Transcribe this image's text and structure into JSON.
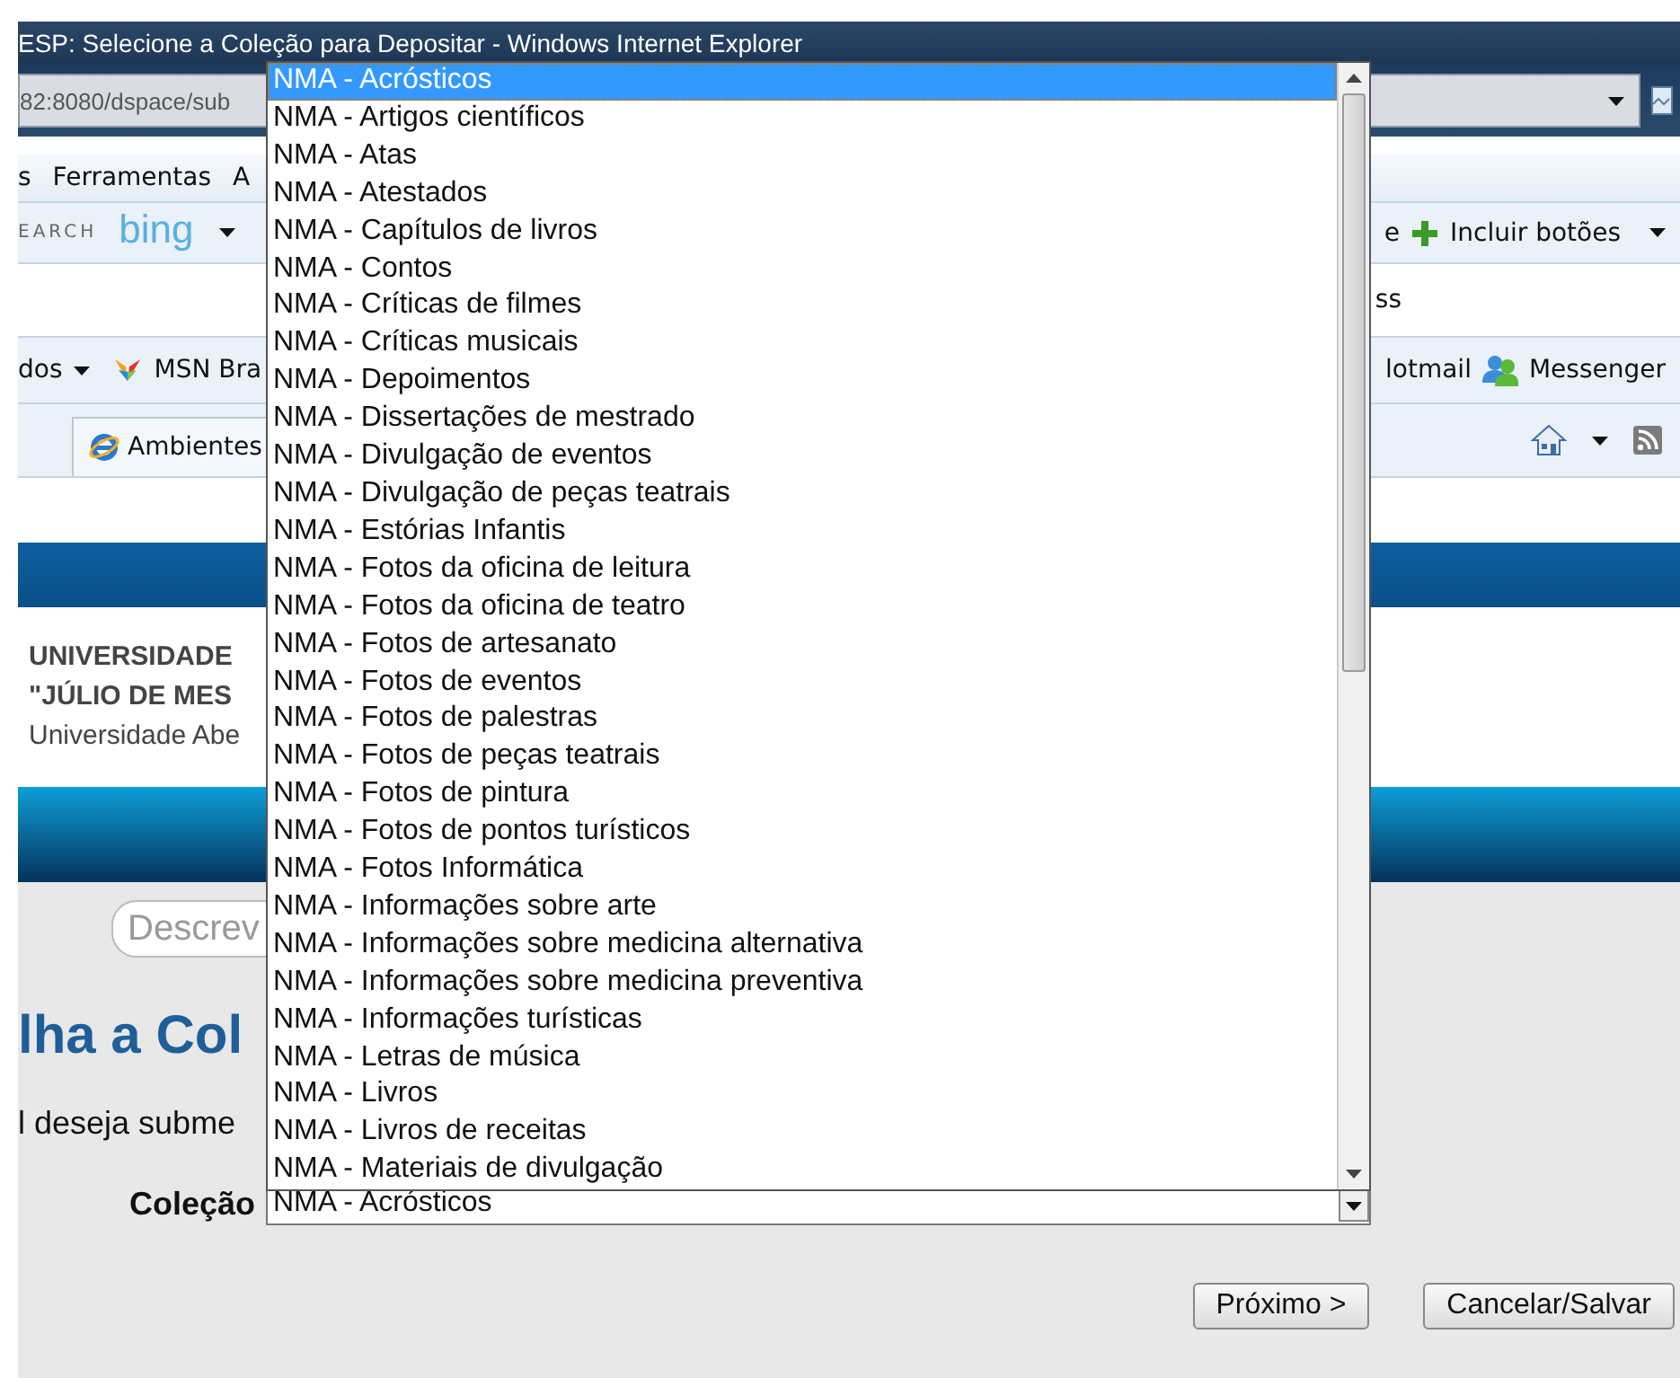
{
  "window": {
    "title": "ESP: Selecione a Coleção para Depositar - Windows Internet Explorer"
  },
  "address_bar": {
    "url": "82:8080/dspace/sub"
  },
  "menu_bar": {
    "items": [
      "s",
      "Ferramentas",
      "A"
    ]
  },
  "search_toolbar": {
    "label": "EARCH",
    "logo": "bing",
    "right_items": [
      "e",
      "Incluir botões"
    ]
  },
  "links_row": {
    "text": "ss"
  },
  "favorites_bar": {
    "items": [
      {
        "label": "dos",
        "kind": "menu"
      },
      {
        "label": "MSN Bra",
        "kind": "msn"
      },
      {
        "label": "lotmail",
        "kind": "plain"
      },
      {
        "label": "Messenger",
        "kind": "messenger"
      }
    ]
  },
  "tab_row": {
    "tab_label": "Ambientes"
  },
  "header": {
    "lines": [
      "UNIVERSIDADE",
      "\"JÚLIO DE MES",
      "Universidade Abe"
    ]
  },
  "page": {
    "search_placeholder": "Descrev",
    "heading": "lha a Col",
    "prompt": "l deseja subme",
    "field_label": "Coleção",
    "selected_value": "NMA - Acrósticos"
  },
  "dropdown": {
    "options": [
      {
        "label": "NMA - Acrósticos",
        "selected": true
      },
      {
        "label": "NMA - Artigos científicos",
        "selected": false
      },
      {
        "label": "NMA - Atas",
        "selected": false
      },
      {
        "label": "NMA - Atestados",
        "selected": false
      },
      {
        "label": "NMA - Capítulos de livros",
        "selected": false
      },
      {
        "label": "NMA - Contos",
        "selected": false
      },
      {
        "label": "NMA - Críticas de filmes",
        "selected": false
      },
      {
        "label": "NMA - Críticas musicais",
        "selected": false
      },
      {
        "label": "NMA - Depoimentos",
        "selected": false
      },
      {
        "label": "NMA - Dissertações de mestrado",
        "selected": false
      },
      {
        "label": "NMA - Divulgação de eventos",
        "selected": false
      },
      {
        "label": "NMA - Divulgação de peças teatrais",
        "selected": false
      },
      {
        "label": "NMA - Estórias Infantis",
        "selected": false
      },
      {
        "label": "NMA - Fotos da oficina de leitura",
        "selected": false
      },
      {
        "label": "NMA - Fotos da oficina de teatro",
        "selected": false
      },
      {
        "label": "NMA - Fotos de artesanato",
        "selected": false
      },
      {
        "label": "NMA - Fotos de eventos",
        "selected": false
      },
      {
        "label": "NMA - Fotos de palestras",
        "selected": false
      },
      {
        "label": "NMA - Fotos de peças teatrais",
        "selected": false
      },
      {
        "label": "NMA - Fotos de pintura",
        "selected": false
      },
      {
        "label": "NMA - Fotos de pontos turísticos",
        "selected": false
      },
      {
        "label": "NMA - Fotos Informática",
        "selected": false
      },
      {
        "label": "NMA - Informações sobre arte",
        "selected": false
      },
      {
        "label": "NMA - Informações sobre medicina alternativa",
        "selected": false
      },
      {
        "label": "NMA - Informações sobre medicina preventiva",
        "selected": false
      },
      {
        "label": "NMA - Informações turísticas",
        "selected": false
      },
      {
        "label": "NMA - Letras de música",
        "selected": false
      },
      {
        "label": "NMA - Livros",
        "selected": false
      },
      {
        "label": "NMA - Livros de receitas",
        "selected": false
      },
      {
        "label": "NMA - Materiais de divulgação",
        "selected": false
      }
    ]
  },
  "buttons": [
    "Próximo >",
    "Cancelar/Salvar"
  ]
}
